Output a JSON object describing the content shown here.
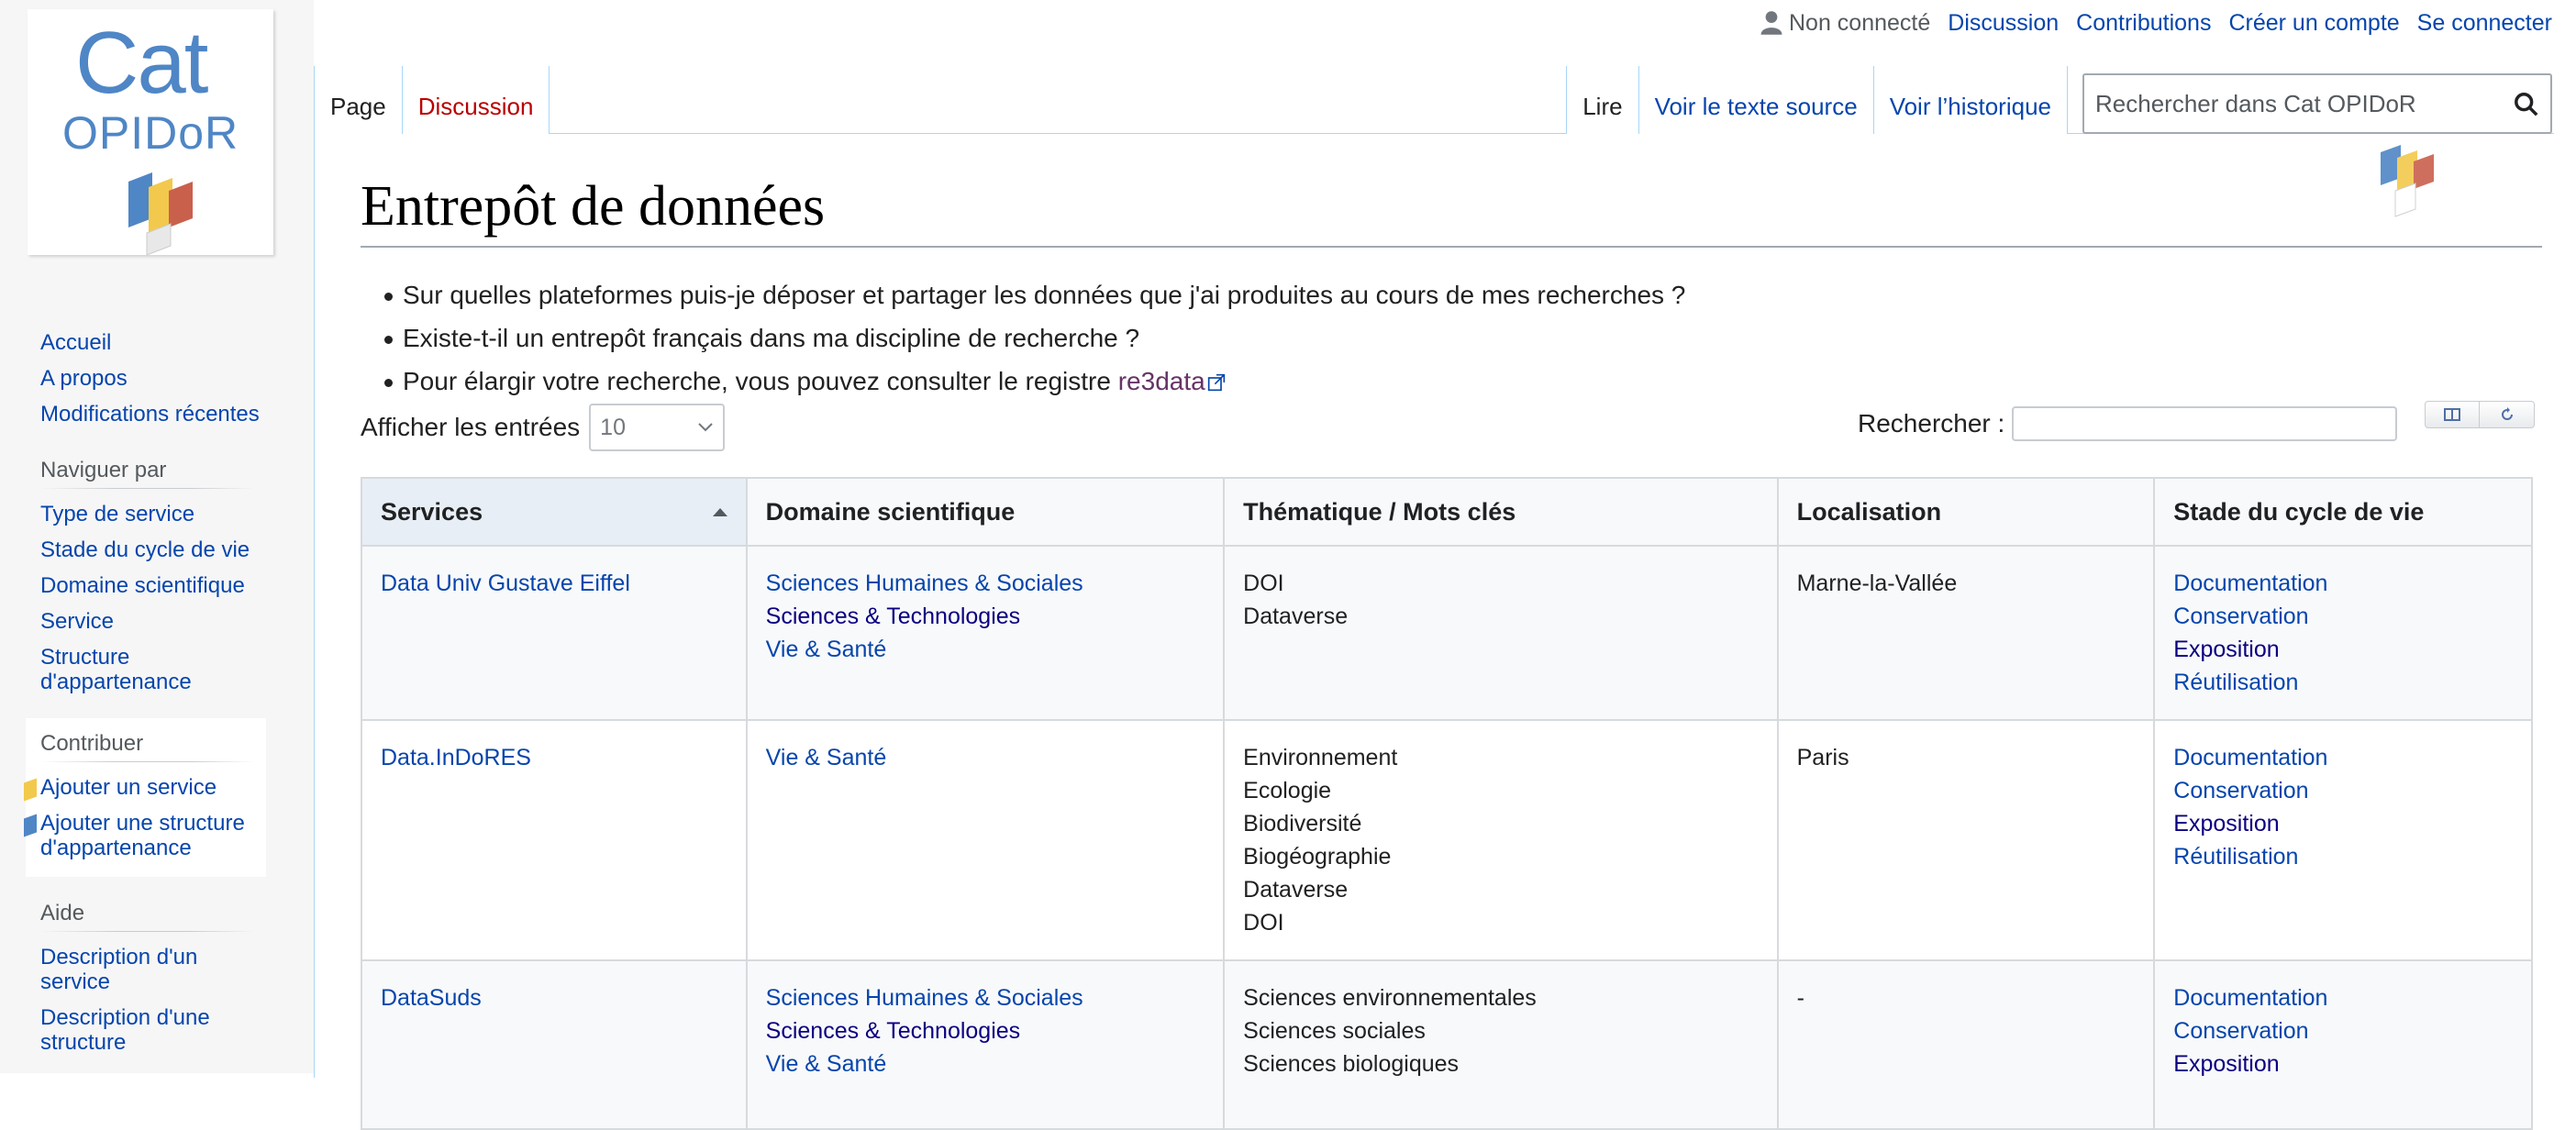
{
  "personal": {
    "status": "Non connecté",
    "links": [
      "Discussion",
      "Contributions",
      "Créer un compte",
      "Se connecter"
    ]
  },
  "logo": {
    "line1": "Cat",
    "line2": "OPIDoR"
  },
  "sidebar": {
    "nav": [
      "Accueil",
      "A propos",
      "Modifications récentes"
    ],
    "browse": {
      "title": "Naviguer par",
      "items": [
        "Type de service",
        "Stade du cycle de vie",
        "Domaine scientifique",
        "Service",
        "Structure d'appartenance"
      ]
    },
    "contribute": {
      "title": "Contribuer",
      "items": [
        "Ajouter un service",
        "Ajouter une structure d'appartenance"
      ]
    },
    "help": {
      "title": "Aide",
      "items": [
        "Description d'un service",
        "Description d'une structure"
      ]
    }
  },
  "tabs": {
    "left": [
      "Page",
      "Discussion"
    ],
    "right": [
      "Lire",
      "Voir le texte source",
      "Voir l’historique"
    ]
  },
  "search": {
    "placeholder": "Rechercher dans Cat OPIDoR"
  },
  "page": {
    "title": "Entrepôt de données",
    "intro": [
      "Sur quelles plateformes puis-je déposer et partager les données que j'ai produites au cours de mes recherches ?",
      "Existe-t-il un entrepôt français dans ma discipline de recherche ?",
      "Pour élargir votre recherche, vous pouvez consulter le registre "
    ],
    "intro_link": "re3data"
  },
  "datatable": {
    "length_label": "Afficher les entrées",
    "length_value": "10",
    "filter_label": "Rechercher :",
    "columns": [
      "Services",
      "Domaine scientifique",
      "Thématique / Mots clés",
      "Localisation",
      "Stade du cycle de vie"
    ],
    "rows": [
      {
        "service": "Data Univ Gustave Eiffel",
        "domaines": [
          "Sciences Humaines & Sociales",
          "Sciences & Technologies",
          "Vie & Santé"
        ],
        "mots_cles": [
          "DOI",
          "Dataverse"
        ],
        "localisation": "Marne-la-Vallée",
        "stades": [
          "Documentation",
          "Conservation",
          "Exposition",
          "Réutilisation"
        ]
      },
      {
        "service": "Data.InDoRES",
        "domaines": [
          "Vie & Santé"
        ],
        "mots_cles": [
          "Environnement",
          "Ecologie",
          "Biodiversité",
          "Biogéographie",
          "Dataverse",
          "DOI"
        ],
        "localisation": "Paris",
        "stades": [
          "Documentation",
          "Conservation",
          "Exposition",
          "Réutilisation"
        ]
      },
      {
        "service": "DataSuds",
        "domaines": [
          "Sciences Humaines & Sociales",
          "Sciences & Technologies",
          "Vie & Santé"
        ],
        "mots_cles": [
          "Sciences environnementales",
          "Sciences sociales",
          "Sciences biologiques"
        ],
        "localisation": "-",
        "stades": [
          "Documentation",
          "Conservation",
          "Exposition"
        ]
      }
    ]
  },
  "colors": {
    "link": "#0645ad",
    "link_visited_dark": "#0b0080",
    "external": "#663366",
    "new_link": "#ba0000"
  }
}
